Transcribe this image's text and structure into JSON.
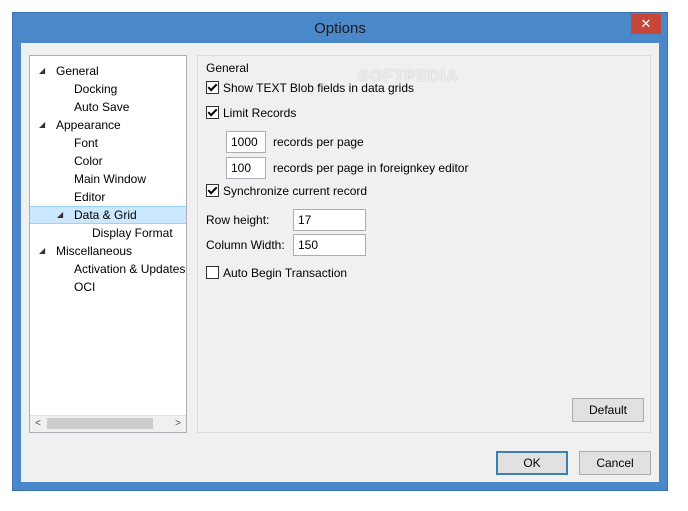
{
  "window": {
    "title": "Options",
    "close_glyph": "✕"
  },
  "tree": {
    "items": [
      {
        "label": "General",
        "level": 0,
        "expanded": true
      },
      {
        "label": "Docking",
        "level": 1
      },
      {
        "label": "Auto Save",
        "level": 1
      },
      {
        "label": "Appearance",
        "level": 0,
        "expanded": true
      },
      {
        "label": "Font",
        "level": 1
      },
      {
        "label": "Color",
        "level": 1
      },
      {
        "label": "Main Window",
        "level": 1
      },
      {
        "label": "Editor",
        "level": 1
      },
      {
        "label": "Data & Grid",
        "level": 1,
        "expanded": true,
        "selected": true
      },
      {
        "label": "Display Format",
        "level": 2
      },
      {
        "label": "Miscellaneous",
        "level": 0,
        "expanded": true
      },
      {
        "label": "Activation & Updates",
        "level": 1
      },
      {
        "label": "OCI",
        "level": 1
      }
    ],
    "expander_glyph": "◢",
    "scroll_left": "<",
    "scroll_right": ">"
  },
  "panel": {
    "group_title": "General",
    "watermark": "SOFTPEDIA",
    "show_text_blob": {
      "label": "Show TEXT Blob fields in data grids",
      "checked": true
    },
    "limit_records": {
      "label": "Limit Records",
      "checked": true
    },
    "records_per_page": {
      "value": "1000",
      "label": "records per page"
    },
    "records_per_page_fk": {
      "value": "100",
      "label": "records per page in foreignkey editor"
    },
    "sync_record": {
      "label": "Synchronize current record",
      "checked": true
    },
    "row_height": {
      "label": "Row height:",
      "value": "17"
    },
    "column_width": {
      "label": "Column Width:",
      "value": "150"
    },
    "auto_begin": {
      "label": "Auto Begin Transaction",
      "checked": false
    },
    "default_button": "Default"
  },
  "footer": {
    "ok_button": "OK",
    "cancel_button": "Cancel"
  },
  "colors": {
    "title_bar": "#4a88c9",
    "selection": "#cce8ff",
    "close": "#c7463a"
  }
}
